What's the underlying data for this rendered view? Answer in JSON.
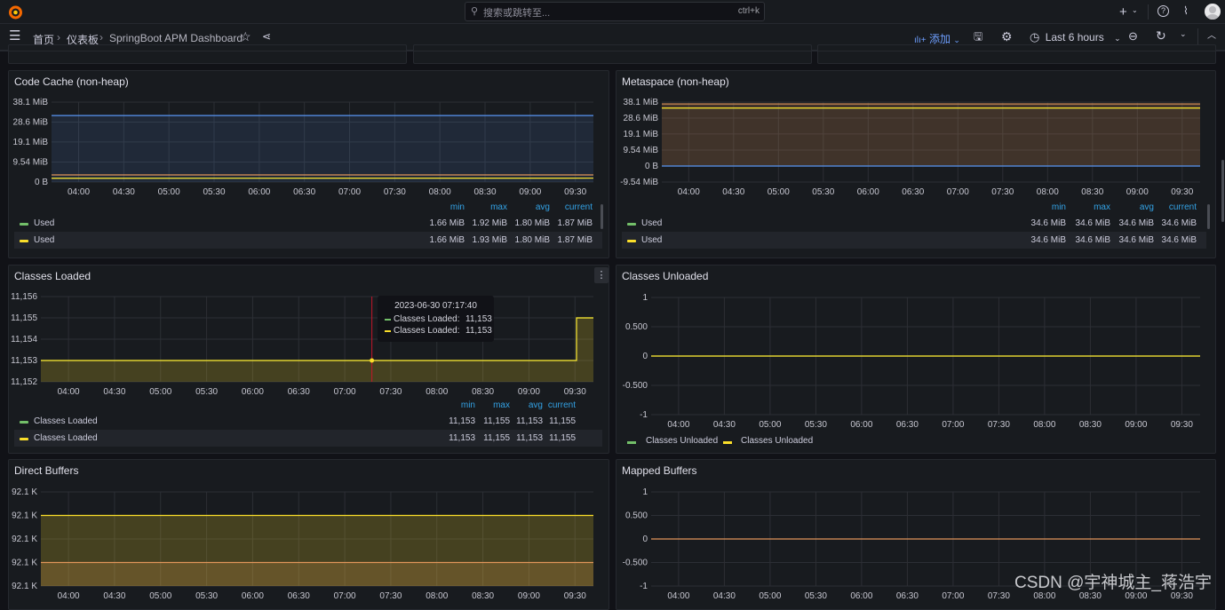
{
  "topbar": {
    "search_placeholder": "搜索或跳转至...",
    "search_shortcut": "ctrl+k",
    "icons": [
      "grafana-logo-icon",
      "search-icon",
      "plus-icon",
      "help-icon",
      "rss-icon",
      "avatar"
    ]
  },
  "navbar": {
    "breadcrumbs": [
      "首页",
      "仪表板",
      "SpringBoot APM Dashboard"
    ],
    "add_label": "添加",
    "time_range": "Last 6 hours"
  },
  "colors": {
    "green": "#73bf69",
    "yellow": "#fade2a",
    "orange": "#e0955a",
    "blue": "#5794f2",
    "legend_header": "#33a2e5",
    "hover_line": "#c4162a"
  },
  "legend_headers": [
    "min",
    "max",
    "avg",
    "current"
  ],
  "panels": [
    {
      "title": "Code Cache (non-heap)",
      "legend": [
        {
          "name": "Used",
          "color": "#73bf69",
          "min": "1.66 MiB",
          "max": "1.92 MiB",
          "avg": "1.80 MiB",
          "current": "1.87 MiB"
        },
        {
          "name": "Used",
          "color": "#fade2a",
          "min": "1.66 MiB",
          "max": "1.93 MiB",
          "avg": "1.80 MiB",
          "current": "1.87 MiB"
        }
      ]
    },
    {
      "title": "Metaspace (non-heap)",
      "legend": [
        {
          "name": "Used",
          "color": "#73bf69",
          "min": "34.6 MiB",
          "max": "34.6 MiB",
          "avg": "34.6 MiB",
          "current": "34.6 MiB"
        },
        {
          "name": "Used",
          "color": "#fade2a",
          "min": "34.6 MiB",
          "max": "34.6 MiB",
          "avg": "34.6 MiB",
          "current": "34.6 MiB"
        }
      ]
    },
    {
      "title": "Classes Loaded",
      "legend": [
        {
          "name": "Classes Loaded",
          "color": "#73bf69",
          "min": "11,153",
          "max": "11,155",
          "avg": "11,153",
          "current": "11,155"
        },
        {
          "name": "Classes Loaded",
          "color": "#fade2a",
          "min": "11,153",
          "max": "11,155",
          "avg": "11,153",
          "current": "11,155"
        }
      ],
      "tooltip": {
        "time": "2023-06-30 07:17:40",
        "rows": [
          {
            "label": "Classes Loaded:",
            "value": "11,153",
            "color": "#73bf69"
          },
          {
            "label": "Classes Loaded:",
            "value": "11,153",
            "color": "#fade2a"
          }
        ]
      }
    },
    {
      "title": "Classes Unloaded",
      "legend": [
        {
          "name": "Classes Unloaded",
          "color": "#73bf69"
        },
        {
          "name": "Classes Unloaded",
          "color": "#fade2a"
        }
      ]
    },
    {
      "title": "Direct Buffers"
    },
    {
      "title": "Mapped Buffers"
    }
  ],
  "chart_data": [
    {
      "type": "line",
      "title": "Code Cache (non-heap)",
      "xlim": [
        "03:42",
        "09:42"
      ],
      "xticks": [
        "04:00",
        "04:30",
        "05:00",
        "05:30",
        "06:00",
        "06:30",
        "07:00",
        "07:30",
        "08:00",
        "08:30",
        "09:00",
        "09:30"
      ],
      "ylim": [
        0,
        38.1
      ],
      "yticks": [
        {
          "v": 0,
          "label": "0 B"
        },
        {
          "v": 9.54,
          "label": "9.54 MiB"
        },
        {
          "v": 19.1,
          "label": "19.1 MiB"
        },
        {
          "v": 28.6,
          "label": "28.6 MiB"
        },
        {
          "v": 38.1,
          "label": "38.1 MiB"
        }
      ],
      "grid": true,
      "series": [
        {
          "color": "#5794f2",
          "fill": true,
          "points": [
            [
              "03:42",
              31.7
            ],
            [
              "09:42",
              31.7
            ]
          ]
        },
        {
          "color": "#e0955a",
          "fill": false,
          "points": [
            [
              "03:42",
              3.4
            ],
            [
              "09:42",
              3.4
            ]
          ]
        },
        {
          "name": "Used",
          "color": "#73bf69",
          "fill": false,
          "points": [
            [
              "03:42",
              1.8
            ],
            [
              "09:42",
              1.87
            ]
          ]
        },
        {
          "name": "Used",
          "color": "#fade2a",
          "fill": false,
          "points": [
            [
              "03:42",
              1.8
            ],
            [
              "09:42",
              1.87
            ]
          ]
        }
      ]
    },
    {
      "type": "line",
      "title": "Metaspace (non-heap)",
      "xlim": [
        "03:42",
        "09:42"
      ],
      "xticks": [
        "04:00",
        "04:30",
        "05:00",
        "05:30",
        "06:00",
        "06:30",
        "07:00",
        "07:30",
        "08:00",
        "08:30",
        "09:00",
        "09:30"
      ],
      "ylim": [
        -9.54,
        38.1
      ],
      "yticks": [
        {
          "v": -9.54,
          "label": "-9.54 MiB"
        },
        {
          "v": 0,
          "label": "0 B"
        },
        {
          "v": 9.54,
          "label": "9.54 MiB"
        },
        {
          "v": 19.1,
          "label": "19.1 MiB"
        },
        {
          "v": 28.6,
          "label": "28.6 MiB"
        },
        {
          "v": 38.1,
          "label": "38.1 MiB"
        }
      ],
      "grid": true,
      "series": [
        {
          "color": "#5794f2",
          "fill": false,
          "points": [
            [
              "03:42",
              0
            ],
            [
              "09:42",
              0
            ]
          ]
        },
        {
          "color": "#e0955a",
          "fill": true,
          "points": [
            [
              "03:42",
              37.0
            ],
            [
              "09:42",
              37.0
            ]
          ]
        },
        {
          "name": "Used",
          "color": "#73bf69",
          "fill": false,
          "points": [
            [
              "03:42",
              34.6
            ],
            [
              "09:42",
              34.6
            ]
          ]
        },
        {
          "name": "Used",
          "color": "#fade2a",
          "fill": false,
          "points": [
            [
              "03:42",
              34.6
            ],
            [
              "09:42",
              34.6
            ]
          ]
        }
      ]
    },
    {
      "type": "line",
      "title": "Classes Loaded",
      "xlim": [
        "03:42",
        "09:42"
      ],
      "xticks": [
        "04:00",
        "04:30",
        "05:00",
        "05:30",
        "06:00",
        "06:30",
        "07:00",
        "07:30",
        "08:00",
        "08:30",
        "09:00",
        "09:30"
      ],
      "ylim": [
        11152,
        11156
      ],
      "yticks": [
        {
          "v": 11152,
          "label": "11,152"
        },
        {
          "v": 11153,
          "label": "11,153"
        },
        {
          "v": 11154,
          "label": "11,154"
        },
        {
          "v": 11155,
          "label": "11,155"
        },
        {
          "v": 11156,
          "label": "11,156"
        }
      ],
      "grid": true,
      "hover": "07:17:40",
      "series": [
        {
          "name": "Classes Loaded",
          "color": "#73bf69",
          "fill": false,
          "points": [
            [
              "03:42",
              11153
            ],
            [
              "09:31",
              11153
            ],
            [
              "09:31",
              11155
            ],
            [
              "09:42",
              11155
            ]
          ]
        },
        {
          "name": "Classes Loaded",
          "color": "#fade2a",
          "fill": true,
          "points": [
            [
              "03:42",
              11153
            ],
            [
              "09:31",
              11153
            ],
            [
              "09:31",
              11155
            ],
            [
              "09:42",
              11155
            ]
          ]
        }
      ]
    },
    {
      "type": "line",
      "title": "Classes Unloaded",
      "xlim": [
        "03:42",
        "09:42"
      ],
      "xticks": [
        "04:00",
        "04:30",
        "05:00",
        "05:30",
        "06:00",
        "06:30",
        "07:00",
        "07:30",
        "08:00",
        "08:30",
        "09:00",
        "09:30"
      ],
      "ylim": [
        -1,
        1
      ],
      "yticks": [
        {
          "v": -1,
          "label": "-1"
        },
        {
          "v": -0.5,
          "label": "-0.500"
        },
        {
          "v": 0,
          "label": "0"
        },
        {
          "v": 0.5,
          "label": "0.500"
        },
        {
          "v": 1,
          "label": "1"
        }
      ],
      "grid": true,
      "series": [
        {
          "name": "Classes Unloaded",
          "color": "#73bf69",
          "fill": false,
          "points": [
            [
              "03:42",
              0
            ],
            [
              "09:42",
              0
            ]
          ]
        },
        {
          "name": "Classes Unloaded",
          "color": "#fade2a",
          "fill": false,
          "points": [
            [
              "03:42",
              0
            ],
            [
              "09:42",
              0
            ]
          ]
        }
      ]
    },
    {
      "type": "line",
      "title": "Direct Buffers",
      "xlim": [
        "03:42",
        "09:42"
      ],
      "xticks": [
        "04:00",
        "04:30",
        "05:00",
        "05:30",
        "06:00",
        "06:30",
        "07:00",
        "07:30",
        "08:00",
        "08:30",
        "09:00",
        "09:30"
      ],
      "ylim": [
        92100,
        92140
      ],
      "yticks": [
        {
          "v": 92100,
          "label": "92.1 K"
        },
        {
          "v": 92110,
          "label": "92.1 K"
        },
        {
          "v": 92120,
          "label": "92.1 K"
        },
        {
          "v": 92130,
          "label": "92.1 K"
        },
        {
          "v": 92140,
          "label": "92.1 K"
        }
      ],
      "grid": true,
      "series": [
        {
          "color": "#e0955a",
          "fill": true,
          "points": [
            [
              "03:42",
              92110
            ],
            [
              "09:42",
              92110
            ]
          ]
        },
        {
          "color": "#fade2a",
          "fill": true,
          "points": [
            [
              "03:42",
              92130
            ],
            [
              "09:42",
              92130
            ]
          ]
        }
      ]
    },
    {
      "type": "line",
      "title": "Mapped Buffers",
      "xlim": [
        "03:42",
        "09:42"
      ],
      "xticks": [
        "04:00",
        "04:30",
        "05:00",
        "05:30",
        "06:00",
        "06:30",
        "07:00",
        "07:30",
        "08:00",
        "08:30",
        "09:00",
        "09:30"
      ],
      "ylim": [
        -1,
        1
      ],
      "yticks": [
        {
          "v": -1,
          "label": "-1"
        },
        {
          "v": -0.5,
          "label": "-0.500"
        },
        {
          "v": 0,
          "label": "0"
        },
        {
          "v": 0.5,
          "label": "0.500"
        },
        {
          "v": 1,
          "label": "1"
        }
      ],
      "grid": true,
      "series": [
        {
          "color": "#e0955a",
          "fill": false,
          "points": [
            [
              "03:42",
              0
            ],
            [
              "09:42",
              0
            ]
          ]
        }
      ]
    }
  ],
  "watermark": "CSDN @宇神城主_蒋浩宇"
}
